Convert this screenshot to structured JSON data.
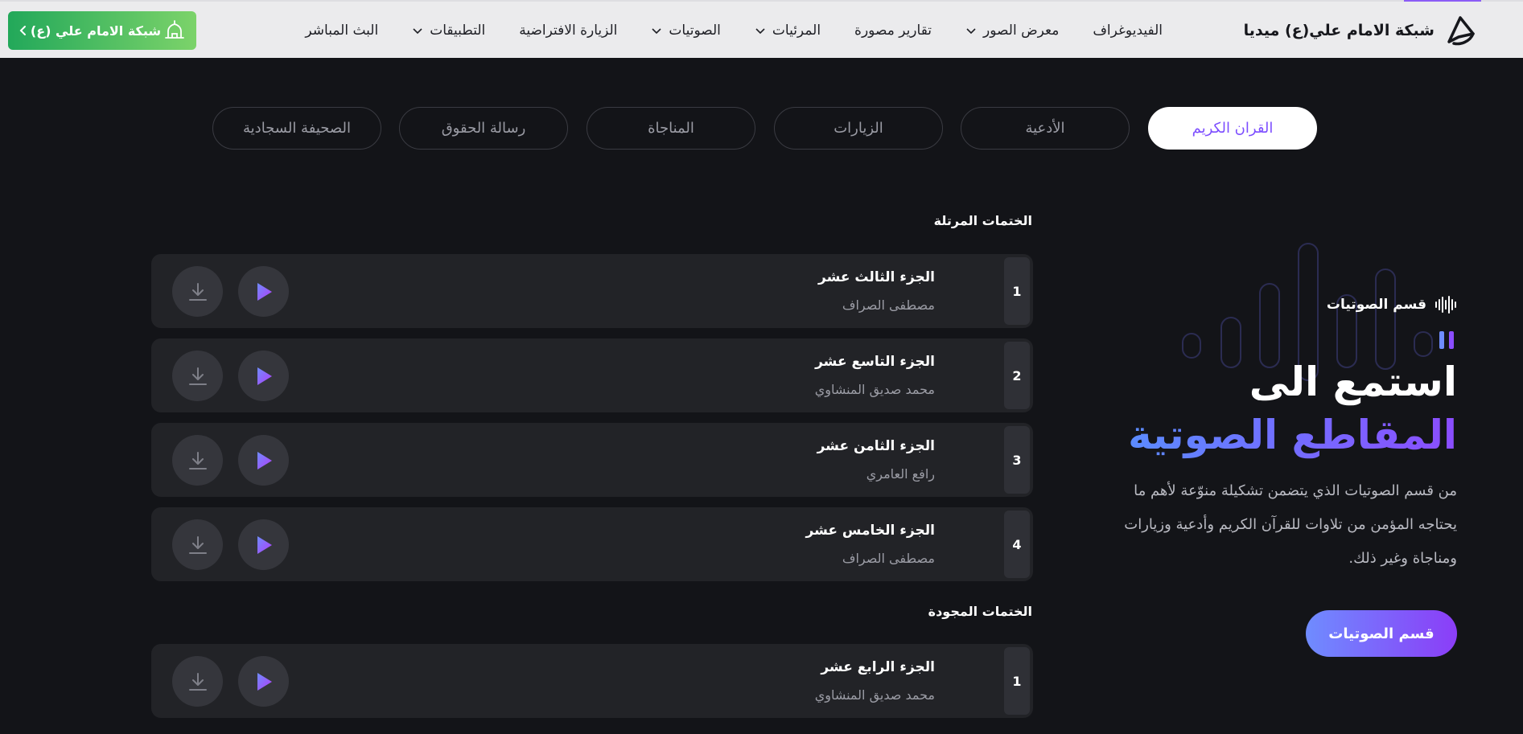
{
  "brand": {
    "name": "شبكة الامام علي(ع) ميديا"
  },
  "nav": {
    "items": [
      {
        "label": "الفيديوغراف",
        "has_dropdown": false
      },
      {
        "label": "معرض الصور",
        "has_dropdown": true
      },
      {
        "label": "تقارير مصورة",
        "has_dropdown": false
      },
      {
        "label": "المرئيات",
        "has_dropdown": true
      },
      {
        "label": "الصوتيات",
        "has_dropdown": true
      },
      {
        "label": "الزيارة الافتراضية",
        "has_dropdown": false
      },
      {
        "label": "التطبيقات",
        "has_dropdown": true
      },
      {
        "label": "البث المباشر",
        "has_dropdown": false
      }
    ]
  },
  "network_button": {
    "label": "شبكة الامام علي (ع)"
  },
  "tabs": [
    {
      "label": "القران الكريم",
      "active": true
    },
    {
      "label": "الأدعية",
      "active": false
    },
    {
      "label": "الزيارات",
      "active": false
    },
    {
      "label": "المناجاة",
      "active": false
    },
    {
      "label": "رسالة الحقوق",
      "active": false
    },
    {
      "label": "الصحيفة السجادية",
      "active": false
    }
  ],
  "sections": {
    "recited": {
      "title": "الختمات المرتلة",
      "tracks": [
        {
          "num": "1",
          "title": "الجزء الثالث عشر",
          "reciter": "مصطفى الصراف"
        },
        {
          "num": "2",
          "title": "الجزء التاسع عشر",
          "reciter": "محمد صديق المنشاوي"
        },
        {
          "num": "3",
          "title": "الجزء الثامن عشر",
          "reciter": "رافع العامري"
        },
        {
          "num": "4",
          "title": "الجزء الخامس عشر",
          "reciter": "مصطفى الصراف"
        }
      ]
    },
    "mujawwad": {
      "title": "الختمات المجودة",
      "tracks": [
        {
          "num": "1",
          "title": "الجزء الرابع عشر",
          "reciter": "محمد صديق المنشاوي"
        }
      ]
    }
  },
  "hero": {
    "badge": "قسم الصوتيات",
    "title_line1": "استمع الى",
    "title_line2": "المقاطع الصوتية",
    "description": "من قسم الصوتيات الذي يتضمن تشكيلة منوّعة لأهم ما يحتاجه المؤمن من تلاوات للقرآن الكريم وأدعية وزيارات ومناجاة وغير ذلك.",
    "cta": "قسم الصوتيات"
  },
  "colors": {
    "accent_purple": "#8b4dff",
    "accent_blue": "#5b8cff",
    "network_green": "#22a85a",
    "background": "#131418"
  },
  "icons": {
    "brand": "brand-logo-icon",
    "play": "play-icon",
    "download": "download-icon",
    "wave": "audio-wave-icon",
    "chevron": "chevron-down-icon",
    "mosque": "mosque-icon",
    "back": "chevron-left-icon"
  }
}
